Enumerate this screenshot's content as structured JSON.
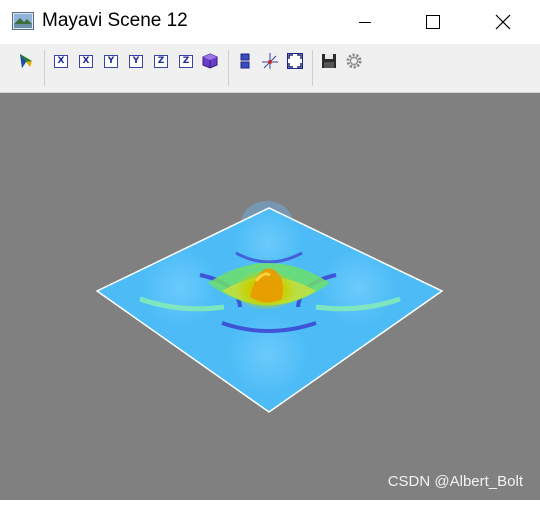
{
  "window": {
    "title": "Mayavi Scene 12"
  },
  "titlebar_buttons": [
    {
      "name": "minimize-button",
      "icon": "minimize-icon"
    },
    {
      "name": "maximize-button",
      "icon": "maximize-icon"
    },
    {
      "name": "close-button",
      "icon": "close-icon"
    }
  ],
  "toolbar": {
    "axis_buttons": [
      {
        "name": "view-plus-x-button",
        "label": "X"
      },
      {
        "name": "view-minus-x-button",
        "label": "X"
      },
      {
        "name": "view-plus-y-button",
        "label": "Y"
      },
      {
        "name": "view-minus-y-button",
        "label": "Y"
      },
      {
        "name": "view-plus-z-button",
        "label": "Z"
      },
      {
        "name": "view-minus-z-button",
        "label": "Z"
      }
    ],
    "icons": [
      "mayavi-pipeline-icon",
      "isometric-view-icon",
      "parallel-projection-icon",
      "axes-indicator-icon",
      "full-screen-icon",
      "save-icon",
      "settings-gear-icon"
    ]
  },
  "scene": {
    "background_color": "#808080",
    "surface_color": "#4dbcf6",
    "watermark": "CSDN @Albert_Bolt"
  }
}
